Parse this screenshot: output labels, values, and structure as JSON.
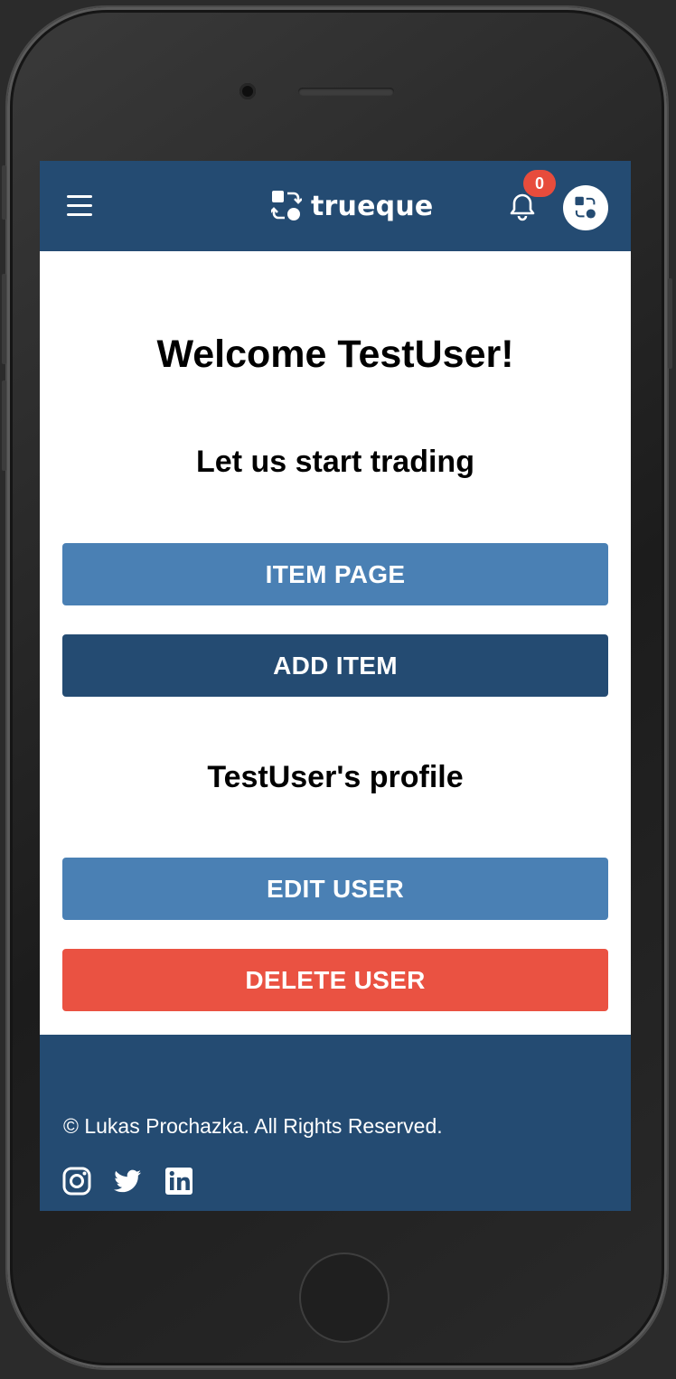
{
  "navbar": {
    "brand": "trueque",
    "notification_count": "0"
  },
  "main": {
    "welcome": "Welcome TestUser!",
    "trading_heading": "Let us start trading",
    "item_page_label": "ITEM PAGE",
    "add_item_label": "ADD ITEM",
    "profile_heading": "TestUser's profile",
    "edit_user_label": "EDIT USER",
    "delete_user_label": "DELETE USER"
  },
  "footer": {
    "copyright": "© Lukas Prochazka. All Rights Reserved.",
    "social_icons": [
      "instagram-icon",
      "twitter-icon",
      "linkedin-icon"
    ]
  },
  "colors": {
    "navbar": "#244b72",
    "primary_button": "#4a80b4",
    "dark_button": "#244b72",
    "danger_button": "#ea5242",
    "badge": "#e74c3c"
  }
}
